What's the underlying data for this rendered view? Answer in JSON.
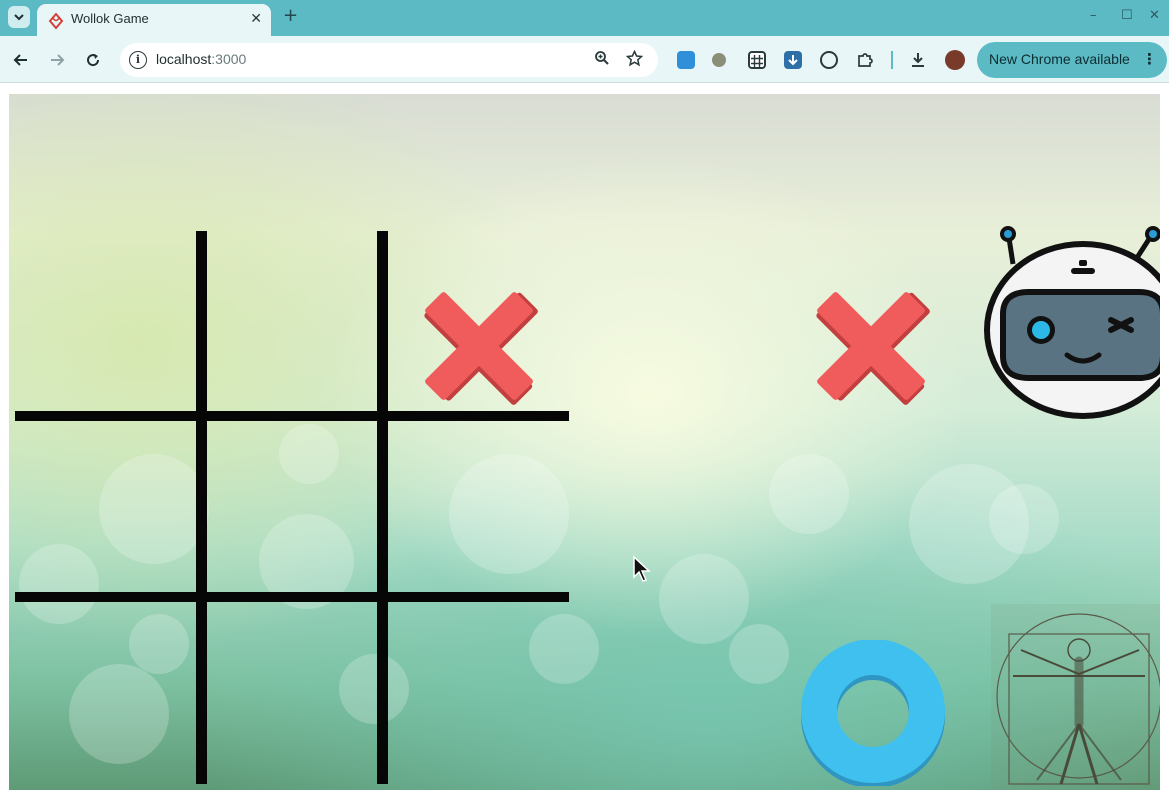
{
  "browser": {
    "tab_title": "Wollok Game",
    "new_tab_symbol": "+",
    "tab_close_symbol": "✕",
    "url_host": "localhost",
    "url_port": ":3000",
    "update_button_label": "New Chrome available",
    "update_menu_symbol": "⋮",
    "window_controls": [
      "–",
      "☐",
      "✕"
    ],
    "accent_color": "#5bbac4"
  },
  "game": {
    "title": "Wollok Game",
    "board": "tic-tac-toe grid",
    "pieces": [
      {
        "type": "X",
        "color": "#f05b5b"
      },
      {
        "type": "X",
        "color": "#f05b5b"
      },
      {
        "type": "O",
        "color": "#3fc0ef"
      }
    ],
    "player_avatar": "robot-face-icon",
    "decoration": "vitruvian-man-image"
  }
}
